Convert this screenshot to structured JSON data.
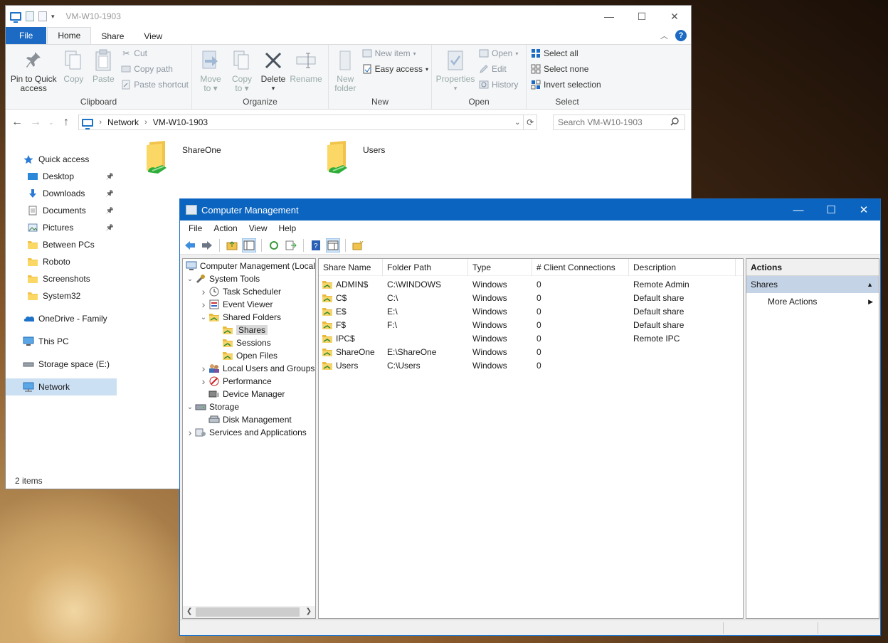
{
  "explorer": {
    "title": "VM-W10-1903",
    "tabs": {
      "file": "File",
      "home": "Home",
      "share": "Share",
      "view": "View"
    },
    "ribbon": {
      "clipboard": {
        "label": "Clipboard",
        "pin_line1": "Pin to Quick",
        "pin_line2": "access",
        "copy": "Copy",
        "paste": "Paste",
        "cut": "Cut",
        "copy_path": "Copy path",
        "paste_shortcut": "Paste shortcut"
      },
      "organize": {
        "label": "Organize",
        "move_to_1": "Move",
        "move_to_2": "to",
        "copy_to_1": "Copy",
        "copy_to_2": "to",
        "delete": "Delete",
        "rename": "Rename"
      },
      "new": {
        "label": "New",
        "new_folder_1": "New",
        "new_folder_2": "folder",
        "new_item": "New item",
        "easy_access": "Easy access"
      },
      "open": {
        "label": "Open",
        "properties": "Properties",
        "open": "Open",
        "edit": "Edit",
        "history": "History"
      },
      "select": {
        "label": "Select",
        "select_all": "Select all",
        "select_none": "Select none",
        "invert_selection": "Invert selection"
      }
    },
    "address": {
      "segments": [
        "Network",
        "VM-W10-1903"
      ]
    },
    "search_placeholder": "Search VM-W10-1903",
    "nav": [
      {
        "label": "Quick access",
        "icon": "star-icon",
        "pinned": false,
        "sub": false
      },
      {
        "label": "Desktop",
        "icon": "desktop-icon",
        "pinned": true,
        "sub": true
      },
      {
        "label": "Downloads",
        "icon": "download-icon",
        "pinned": true,
        "sub": true
      },
      {
        "label": "Documents",
        "icon": "document-icon",
        "pinned": true,
        "sub": true
      },
      {
        "label": "Pictures",
        "icon": "pictures-icon",
        "pinned": true,
        "sub": true
      },
      {
        "label": "Between PCs",
        "icon": "folder-icon",
        "pinned": false,
        "sub": true
      },
      {
        "label": "Roboto",
        "icon": "folder-icon",
        "pinned": false,
        "sub": true
      },
      {
        "label": "Screenshots",
        "icon": "folder-icon",
        "pinned": false,
        "sub": true
      },
      {
        "label": "System32",
        "icon": "folder-icon",
        "pinned": false,
        "sub": true
      },
      {
        "label": "OneDrive - Family",
        "icon": "onedrive-icon",
        "pinned": false,
        "sub": false
      },
      {
        "label": "This PC",
        "icon": "this-pc-icon",
        "pinned": false,
        "sub": false
      },
      {
        "label": "Storage space (E:)",
        "icon": "drive-icon",
        "pinned": false,
        "sub": false
      },
      {
        "label": "Network",
        "icon": "network-icon",
        "pinned": false,
        "sub": false,
        "selected": true
      }
    ],
    "folders": [
      "ShareOne",
      "Users"
    ],
    "status": "2 items"
  },
  "cm": {
    "title": "Computer Management",
    "menu": [
      "File",
      "Action",
      "View",
      "Help"
    ],
    "tree": [
      {
        "label": "Computer Management (Local",
        "level": 0,
        "twisty": "",
        "icon": "computer-management-icon"
      },
      {
        "label": "System Tools",
        "level": 0,
        "twisty": "v",
        "icon": "tools-icon"
      },
      {
        "label": "Task Scheduler",
        "level": 1,
        "twisty": ">",
        "icon": "clock-icon"
      },
      {
        "label": "Event Viewer",
        "level": 1,
        "twisty": ">",
        "icon": "event-viewer-icon"
      },
      {
        "label": "Shared Folders",
        "level": 1,
        "twisty": "v",
        "icon": "shared-folder-icon"
      },
      {
        "label": "Shares",
        "level": 2,
        "twisty": "",
        "icon": "shared-folder-icon",
        "selected": true
      },
      {
        "label": "Sessions",
        "level": 2,
        "twisty": "",
        "icon": "shared-folder-icon"
      },
      {
        "label": "Open Files",
        "level": 2,
        "twisty": "",
        "icon": "shared-folder-icon"
      },
      {
        "label": "Local Users and Groups",
        "level": 1,
        "twisty": ">",
        "icon": "users-icon"
      },
      {
        "label": "Performance",
        "level": 1,
        "twisty": ">",
        "icon": "performance-icon"
      },
      {
        "label": "Device Manager",
        "level": 1,
        "twisty": "",
        "icon": "device-manager-icon"
      },
      {
        "label": "Storage",
        "level": 0,
        "twisty": "v",
        "icon": "storage-icon"
      },
      {
        "label": "Disk Management",
        "level": 1,
        "twisty": "",
        "icon": "disk-icon"
      },
      {
        "label": "Services and Applications",
        "level": 0,
        "twisty": ">",
        "icon": "services-icon"
      }
    ],
    "columns": [
      "Share Name",
      "Folder Path",
      "Type",
      "# Client Connections",
      "Description"
    ],
    "rows": [
      [
        "ADMIN$",
        "C:\\WINDOWS",
        "Windows",
        "0",
        "Remote Admin"
      ],
      [
        "C$",
        "C:\\",
        "Windows",
        "0",
        "Default share"
      ],
      [
        "E$",
        "E:\\",
        "Windows",
        "0",
        "Default share"
      ],
      [
        "F$",
        "F:\\",
        "Windows",
        "0",
        "Default share"
      ],
      [
        "IPC$",
        "",
        "Windows",
        "0",
        "Remote IPC"
      ],
      [
        "ShareOne",
        "E:\\ShareOne",
        "Windows",
        "0",
        ""
      ],
      [
        "Users",
        "C:\\Users",
        "Windows",
        "0",
        ""
      ]
    ],
    "actions": {
      "header": "Actions",
      "section": "Shares",
      "more": "More Actions"
    }
  }
}
